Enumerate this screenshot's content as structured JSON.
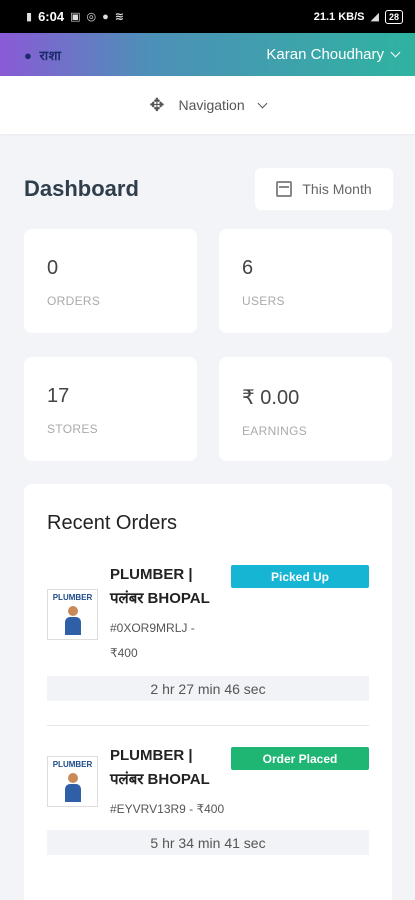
{
  "status_bar": {
    "time": "6:04",
    "network": "21.1 KB/S",
    "battery": "28"
  },
  "header": {
    "logo_text": "राशा",
    "user_name": "Karan Choudhary"
  },
  "nav": {
    "label": "Navigation"
  },
  "dashboard": {
    "title": "Dashboard",
    "period_label": "This Month"
  },
  "stats": [
    {
      "value": "0",
      "label": "ORDERS"
    },
    {
      "value": "6",
      "label": "USERS"
    },
    {
      "value": "17",
      "label": "STORES"
    },
    {
      "value": "₹ 0.00",
      "label": "EARNINGS"
    }
  ],
  "recent_orders": {
    "title": "Recent Orders",
    "items": [
      {
        "name_line1": "PLUMBER |",
        "name_line2": "पलंबर BHOPAL",
        "id_line1": "#0XOR9MRLJ -",
        "id_line2": "₹400",
        "status": "Picked Up",
        "status_color": "#17b5d4",
        "timer": "2 hr 27 min 46 sec",
        "image_brand": "PLUMBER"
      },
      {
        "name_line1": "PLUMBER |",
        "name_line2": "पलंबर BHOPAL",
        "id_line1": "#EYVRV13R9 - ₹400",
        "status": "Order Placed",
        "status_color": "#1fb673",
        "timer": "5 hr 34 min 41 sec",
        "image_brand": "PLUMBER"
      }
    ]
  }
}
